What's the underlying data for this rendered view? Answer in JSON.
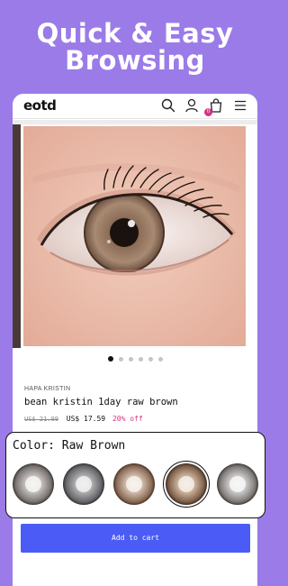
{
  "headline": {
    "line1": "Quick & Easy",
    "line2": "Browsing"
  },
  "header": {
    "logo": "eotd",
    "cart_count": "0",
    "icons": [
      "search-icon",
      "account-icon",
      "cart-icon",
      "menu-icon"
    ]
  },
  "gallery": {
    "slide_count": 6,
    "active_index": 0
  },
  "product": {
    "brand": "HAPA KRISTIN",
    "name": "bean kristin 1day raw brown",
    "old_price": "US$ 21.99",
    "price": "US$ 17.59",
    "discount": "20% off"
  },
  "color_picker": {
    "label": "Color: Raw Brown",
    "swatches": [
      {
        "name": "gray",
        "selected": false
      },
      {
        "name": "dark-gray",
        "selected": false
      },
      {
        "name": "brown",
        "selected": false
      },
      {
        "name": "raw-brown",
        "selected": true
      },
      {
        "name": "gray-light",
        "selected": false
      }
    ]
  },
  "add_to_cart": {
    "label": "Add to cart"
  },
  "colors": {
    "background": "#9b7be8",
    "accent": "#4a5cf5",
    "discount": "#d63384"
  }
}
